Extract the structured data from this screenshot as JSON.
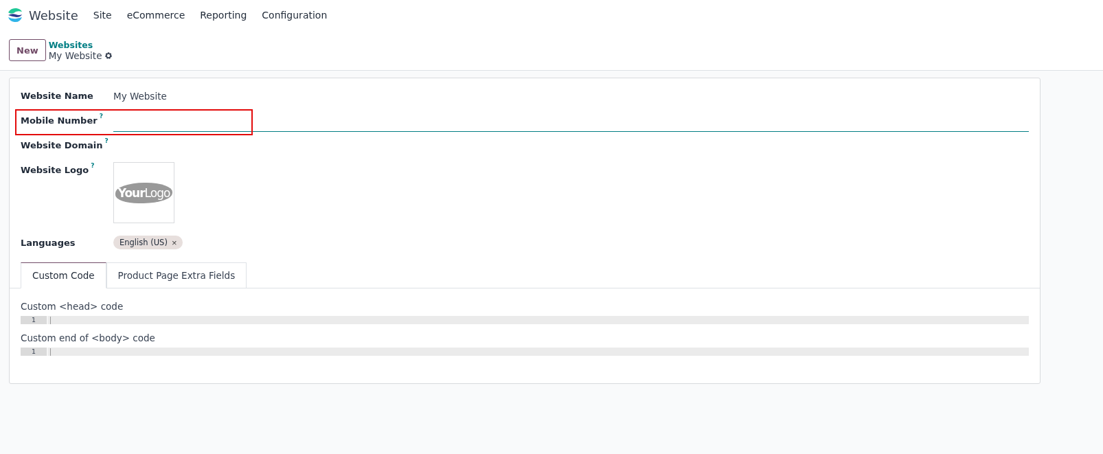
{
  "navbar": {
    "app_name": "Website",
    "menu": [
      "Site",
      "eCommerce",
      "Reporting",
      "Configuration"
    ]
  },
  "control_panel": {
    "new_button": "New",
    "breadcrumb": "Websites",
    "record_title": "My Website"
  },
  "form": {
    "fields": [
      {
        "kind": "text",
        "label": "Website Name",
        "help": false,
        "value": "My Website"
      },
      {
        "kind": "input",
        "label": "Mobile Number",
        "help": true,
        "highlighted": true
      },
      {
        "kind": "text",
        "label": "Website Domain",
        "help": true
      },
      {
        "kind": "image",
        "label": "Website Logo",
        "help": true,
        "logo_text": "**Your**Logo"
      },
      {
        "kind": "tags",
        "label": "Languages",
        "help": false,
        "tags": [
          "English (US)"
        ],
        "remove_mark": "×"
      }
    ],
    "help_mark": "?",
    "tabs": [
      {
        "label": "Custom Code",
        "selected": true
      },
      {
        "label": "Product Page Extra Fields",
        "selected": false
      }
    ],
    "code_fields": [
      {
        "label": "Custom <head> code",
        "line": "1"
      },
      {
        "label": "Custom end of <body> code",
        "line": "1"
      }
    ]
  }
}
